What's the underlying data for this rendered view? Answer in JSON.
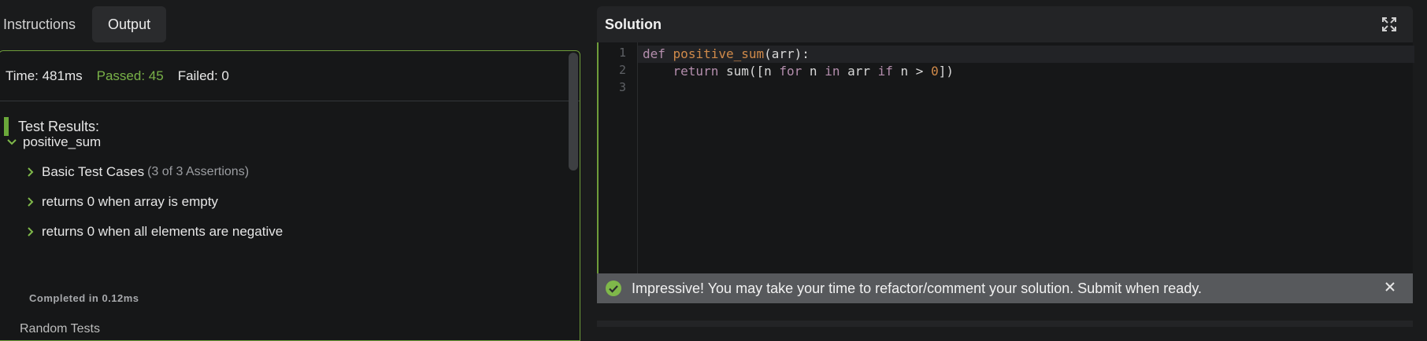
{
  "tabs": {
    "instructions": "Instructions",
    "output": "Output"
  },
  "stats": {
    "time": "Time: 481ms",
    "passed": "Passed: 45",
    "failed": "Failed: 0"
  },
  "results": {
    "title": "Test Results:",
    "suite": "positive_sum",
    "items": [
      {
        "label": "Basic Test Cases",
        "count": "(3 of 3 Assertions)"
      },
      {
        "label": "returns 0 when array is empty",
        "count": ""
      },
      {
        "label": "returns 0 when all elements are negative",
        "count": ""
      }
    ],
    "completed": "Completed in 0.12ms",
    "cutoff": "Random Tests"
  },
  "solution": {
    "title": "Solution",
    "line_numbers": [
      "1",
      "2",
      "3"
    ],
    "code": {
      "line1": {
        "kw": "def",
        "fn": "positive_sum",
        "rest": "(arr):"
      },
      "line2": {
        "indent": "    ",
        "kw_return": "return",
        "p1": " sum([n ",
        "kw_for": "for",
        "p2": " n ",
        "kw_in": "in",
        "p3": " arr ",
        "kw_if": "if",
        "p4": " n > ",
        "num": "0",
        "p5": "])"
      }
    }
  },
  "notice": {
    "text": "Impressive! You may take your time to refactor/comment your solution. Submit when ready."
  },
  "icons": {
    "chevron": "chevron-icon",
    "expand": "expand-icon",
    "check": "check-circle-icon",
    "close": "close-icon"
  },
  "colors": {
    "accent_green": "#6aa83a",
    "passed_green": "#79b248",
    "keyword_purple": "#b48ead",
    "function_orange": "#d08a4a"
  }
}
